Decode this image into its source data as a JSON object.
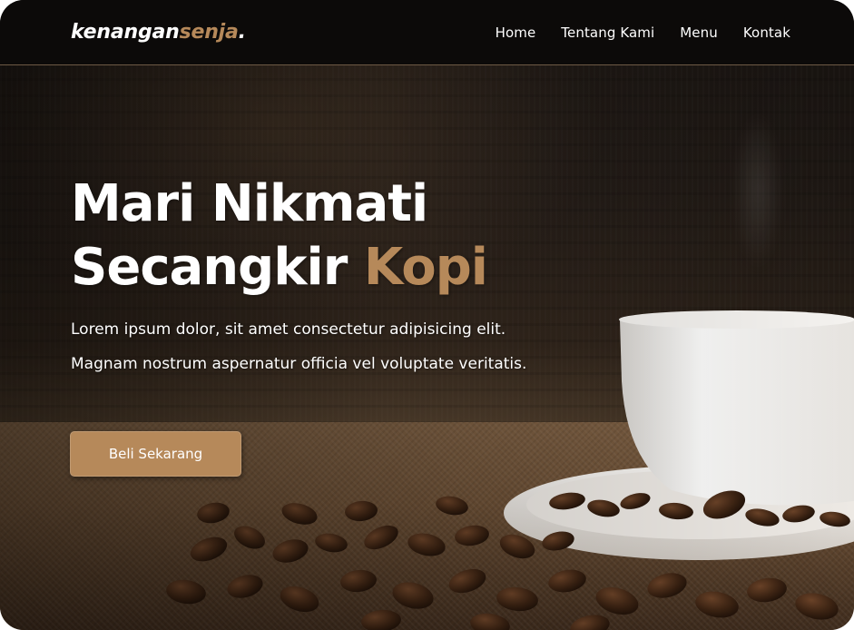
{
  "navbar": {
    "logo": {
      "part1": "kenangan",
      "part2": "senja",
      "dot": "."
    },
    "links": [
      {
        "label": "Home"
      },
      {
        "label": "Tentang Kami"
      },
      {
        "label": "Menu"
      },
      {
        "label": "Kontak"
      }
    ]
  },
  "hero": {
    "title_line1": "Mari Nikmati",
    "title_line2_plain": "Secangkir",
    "title_line2_accent": "Kopi",
    "description": "Lorem ipsum dolor, sit amet consectetur adipisicing elit. Magnam nostrum aspernatur officia vel voluptate veritatis.",
    "cta_label": "Beli Sekarang"
  },
  "colors": {
    "accent": "#b6895a",
    "navbar_bg": "#0c0a09",
    "text": "#ffffff"
  },
  "icons": {
    "hero_image": "coffee-cup-with-beans-image"
  }
}
